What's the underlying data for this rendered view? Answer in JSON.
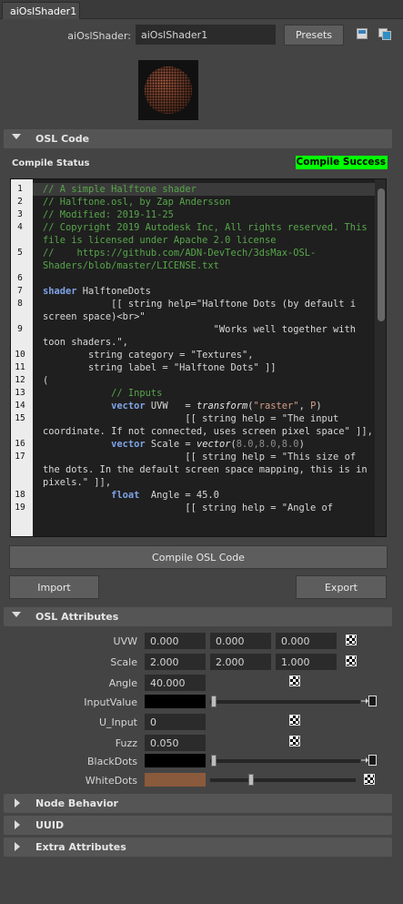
{
  "tab": {
    "label": "aiOslShader1"
  },
  "header": {
    "shader_label": "aiOslShader:",
    "shader_value": "aiOslShader1",
    "presets_label": "Presets"
  },
  "osl_code": {
    "section_title": "OSL Code",
    "compile_status_label": "Compile Status",
    "compile_status_value": "Compile Success",
    "compile_status_color": "#00ff00",
    "compile_button": "Compile OSL Code",
    "import_button": "Import",
    "export_button": "Export",
    "lines": [
      {
        "n": "1",
        "html": "<span class=\"cm\">// A simple Halftone shader</span>"
      },
      {
        "n": "2",
        "html": "<span class=\"cm\">// Halftone.osl, by Zap Andersson</span>"
      },
      {
        "n": "3",
        "html": "<span class=\"cm\">// Modified: 2019-11-25</span>"
      },
      {
        "n": "4",
        "html": "<span class=\"cm\">// Copyright 2019 Autodesk Inc, All rights reserved. This file is licensed under Apache 2.0 license</span>"
      },
      {
        "n": "5",
        "html": "<span class=\"cm\">//    https://github.com/ADN-DevTech/3dsMax-OSL-Shaders/blob/master/LICENSE.txt</span>"
      },
      {
        "n": "6",
        "html": " "
      },
      {
        "n": "7",
        "html": "<span class=\"kw\">shader</span> HalftoneDots"
      },
      {
        "n": "8",
        "html": "            [[ string help=\"Halftone Dots (by default i screen space)&lt;br&gt;\""
      },
      {
        "n": "9",
        "html": "                              \"Works well together with toon shaders.\","
      },
      {
        "n": "10",
        "html": "        string category = \"Textures\","
      },
      {
        "n": "11",
        "html": "        string label = \"Halftone Dots\" ]]"
      },
      {
        "n": "12",
        "html": "("
      },
      {
        "n": "13",
        "html": "            <span class=\"cm\">// Inputs</span>"
      },
      {
        "n": "14",
        "html": "            <span class=\"kw\">vector</span> UVW   = <span class=\"fn\">transform</span>(<span class=\"str\">\"raster\"</span>, <span class=\"str\">P</span>)"
      },
      {
        "n": "15",
        "html": "                         [[ string help = \"The input coordinate. If not connected, uses screen pixel space\" ]],"
      },
      {
        "n": "16",
        "html": "            <span class=\"kw\">vector</span> Scale = <span class=\"fn\">vector</span>(<span class=\"num\">8.0,8.0,8.0</span>)"
      },
      {
        "n": "17",
        "html": "                         [[ string help = \"This size of the dots. In the default screen space mapping, this is in pixels.\" ]],"
      },
      {
        "n": "18",
        "html": "            <span class=\"kw\">float</span>  Angle = 45.0"
      },
      {
        "n": "19",
        "html": "                         [[ string help = \"Angle of"
      }
    ]
  },
  "osl_attributes": {
    "section_title": "OSL Attributes",
    "uvw": {
      "label": "UVW",
      "x": "0.000",
      "y": "0.000",
      "z": "0.000"
    },
    "scale": {
      "label": "Scale",
      "x": "2.000",
      "y": "2.000",
      "z": "1.000"
    },
    "angle": {
      "label": "Angle",
      "value": "40.000"
    },
    "input_value": {
      "label": "InputValue",
      "color": "#000000"
    },
    "u_input": {
      "label": "U_Input",
      "value": "0"
    },
    "fuzz": {
      "label": "Fuzz",
      "value": "0.050"
    },
    "black_dots": {
      "label": "BlackDots",
      "color": "#000000"
    },
    "white_dots": {
      "label": "WhiteDots",
      "color": "#8a5a3c"
    }
  },
  "collapsed_sections": [
    {
      "title": "Node Behavior"
    },
    {
      "title": "UUID"
    },
    {
      "title": "Extra Attributes"
    }
  ]
}
